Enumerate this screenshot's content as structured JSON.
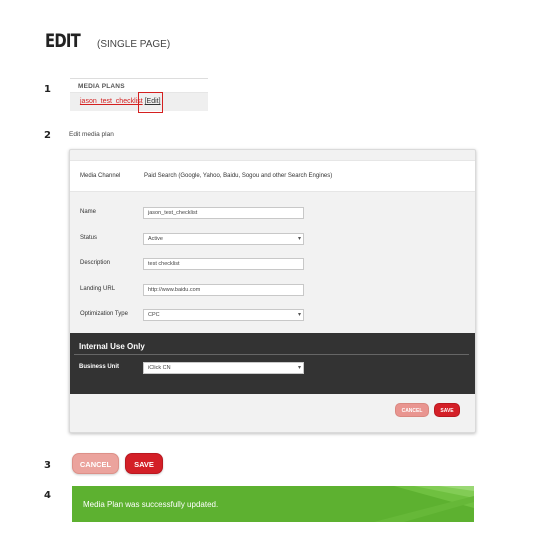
{
  "title": {
    "main": "EDIT",
    "sub": "(SINGLE PAGE)"
  },
  "steps": [
    "1",
    "2",
    "3",
    "4"
  ],
  "media_plans": {
    "header": "MEDIA PLANS",
    "plan_name": "jason_test_checklist",
    "edit_label": "[Edit]"
  },
  "edit_form": {
    "heading": "Edit media plan",
    "media_channel": {
      "label": "Media Channel",
      "value": "Paid Search (Google, Yahoo, Baidu, Sogou and other Search Engines)"
    },
    "fields": {
      "name": {
        "label": "Name",
        "value": "jason_test_checklist"
      },
      "status": {
        "label": "Status",
        "value": "Active"
      },
      "description": {
        "label": "Description",
        "value": "test checklist"
      },
      "landing_url": {
        "label": "Landing URL",
        "value": "http://www.baidu.com"
      },
      "optimization_type": {
        "label": "Optimization Type",
        "value": "CPC"
      }
    },
    "internal": {
      "title": "Internal Use Only",
      "business_unit": {
        "label": "Business Unit",
        "value": "iClick CN"
      }
    },
    "cancel_label": "CANCEL",
    "save_label": "SAVE"
  },
  "step3": {
    "cancel_label": "CANCEL",
    "save_label": "SAVE"
  },
  "success_message": "Media Plan was successfully updated.",
  "colors": {
    "accent_red": "#d42028",
    "success_green": "#5db130",
    "dark_panel": "#333333"
  },
  "icons": {
    "dropdown": "chevron-down-icon"
  }
}
